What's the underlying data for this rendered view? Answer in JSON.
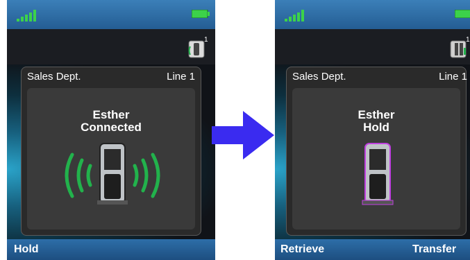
{
  "left_screen": {
    "contact_group": "Sales Dept.",
    "line": "Line 1",
    "caller_name": "Esther",
    "caller_state": "Connected",
    "softkey_left": "Hold",
    "call_icon_badge": "1",
    "icons": {
      "signal": "signal-strength-icon",
      "battery": "battery-icon",
      "call": "active-call-icon",
      "phone": "handset-icon"
    }
  },
  "right_screen": {
    "contact_group": "Sales Dept.",
    "line": "Line 1",
    "caller_name": "Esther",
    "caller_state": "Hold",
    "softkey_left": "Retrieve",
    "softkey_right": "Transfer",
    "call_icon_badge": "1",
    "icons": {
      "signal": "signal-strength-icon",
      "battery": "battery-icon",
      "call": "held-call-icon",
      "phone": "handset-icon"
    }
  },
  "colors": {
    "accent_blue": "#2d6ea8",
    "connected_waves": "#22b24c",
    "hold_outline": "#c040e0",
    "arrow": "#3a2bf0"
  }
}
